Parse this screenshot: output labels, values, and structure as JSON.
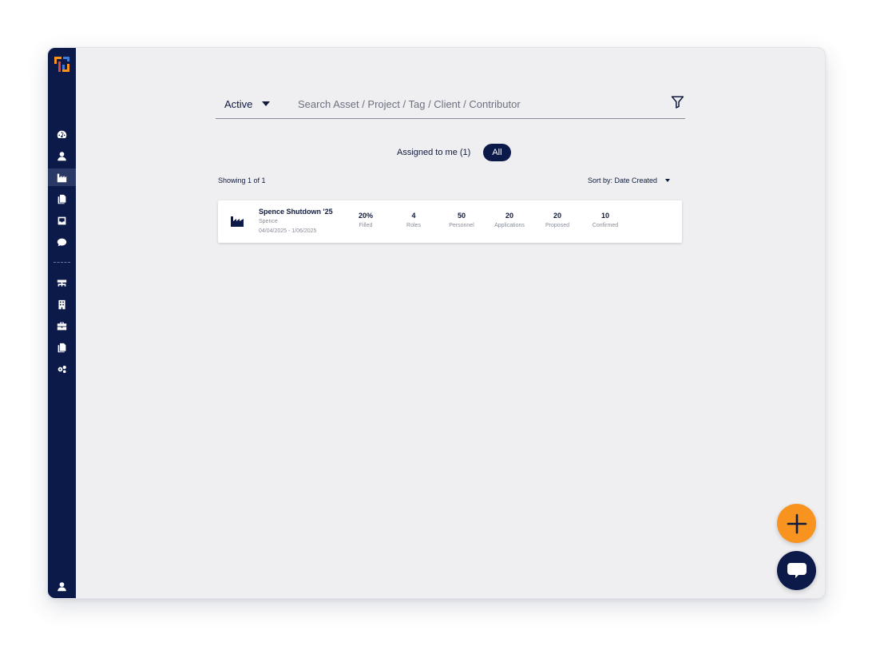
{
  "search": {
    "status_label": "Active",
    "placeholder": "Search Asset / Project / Tag / Client / Contributor"
  },
  "toggles": {
    "assigned_label": "Assigned to me (1)",
    "all_label": "All"
  },
  "list": {
    "showing_text": "Showing 1 of 1",
    "sort_label": "Sort by: Date Created"
  },
  "card": {
    "title": "Spence Shutdown '25",
    "client": "Spence",
    "dates": "04/04/2025 - 1/06/2025",
    "stats": [
      {
        "value": "20%",
        "label": "Filled"
      },
      {
        "value": "4",
        "label": "Roles"
      },
      {
        "value": "50",
        "label": "Personnel"
      },
      {
        "value": "20",
        "label": "Applications"
      },
      {
        "value": "20",
        "label": "Proposed"
      },
      {
        "value": "10",
        "label": "Confirmed"
      }
    ]
  },
  "sidebar": {
    "items": [
      {
        "icon": "dashboard-icon"
      },
      {
        "icon": "user-icon"
      },
      {
        "icon": "factory-icon",
        "active": true
      },
      {
        "icon": "documents-icon"
      },
      {
        "icon": "inbox-icon"
      },
      {
        "icon": "chat-icon"
      },
      {
        "icon": "org-chart-icon"
      },
      {
        "icon": "building-icon"
      },
      {
        "icon": "toolbox-icon"
      },
      {
        "icon": "documents-icon"
      },
      {
        "icon": "settings-icon"
      },
      {
        "icon": "profile-icon"
      }
    ]
  },
  "colors": {
    "sidebar_bg": "#0c1a4a",
    "accent_orange": "#f7931e",
    "content_bg": "#efeff1"
  }
}
